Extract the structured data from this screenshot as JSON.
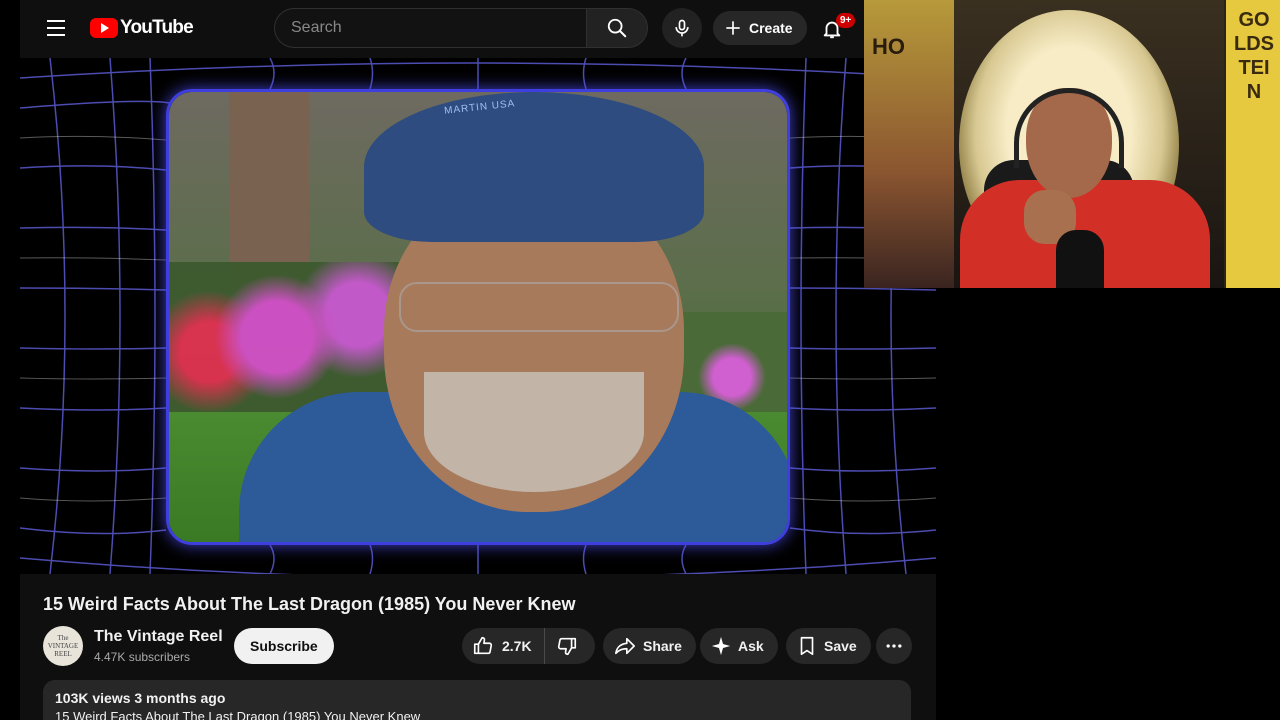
{
  "header": {
    "logo_text": "YouTube",
    "search_placeholder": "Search",
    "create_label": "Create",
    "notifications_badge": "9+"
  },
  "video": {
    "title": "15 Weird Facts About The Last Dragon (1985) You Never Knew",
    "cap_text": "MARTIN USA"
  },
  "channel": {
    "name": "The Vintage Reel",
    "subscribers": "4.47K subscribers",
    "avatar_text": "The VINTAGE REEL",
    "subscribe_label": "Subscribe"
  },
  "actions": {
    "likes": "2.7K",
    "share_label": "Share",
    "ask_label": "Ask",
    "save_label": "Save"
  },
  "description": {
    "meta": "103K views  3 months ago",
    "first_line": "15 Weird Facts About The Last Dragon (1985) You Never Knew"
  },
  "webcam": {
    "flag_text": "GOLDSTEIN",
    "left_letters": "HO"
  },
  "colors": {
    "brand_red": "#ff0000",
    "background": "#0f0f0f",
    "pill_bg": "#272727",
    "frame_glow": "#3f3fe0",
    "flag_yellow": "#e7c940",
    "shirt_red": "#d23026"
  },
  "icons": {
    "menu": "hamburger-icon",
    "search": "search-icon",
    "mic": "microphone-icon",
    "create": "plus-icon",
    "bell": "bell-icon",
    "like": "thumbs-up-icon",
    "dislike": "thumbs-down-icon",
    "share": "share-arrow-icon",
    "ask": "sparkle-icon",
    "save": "bookmark-icon",
    "more": "more-horizontal-icon"
  }
}
